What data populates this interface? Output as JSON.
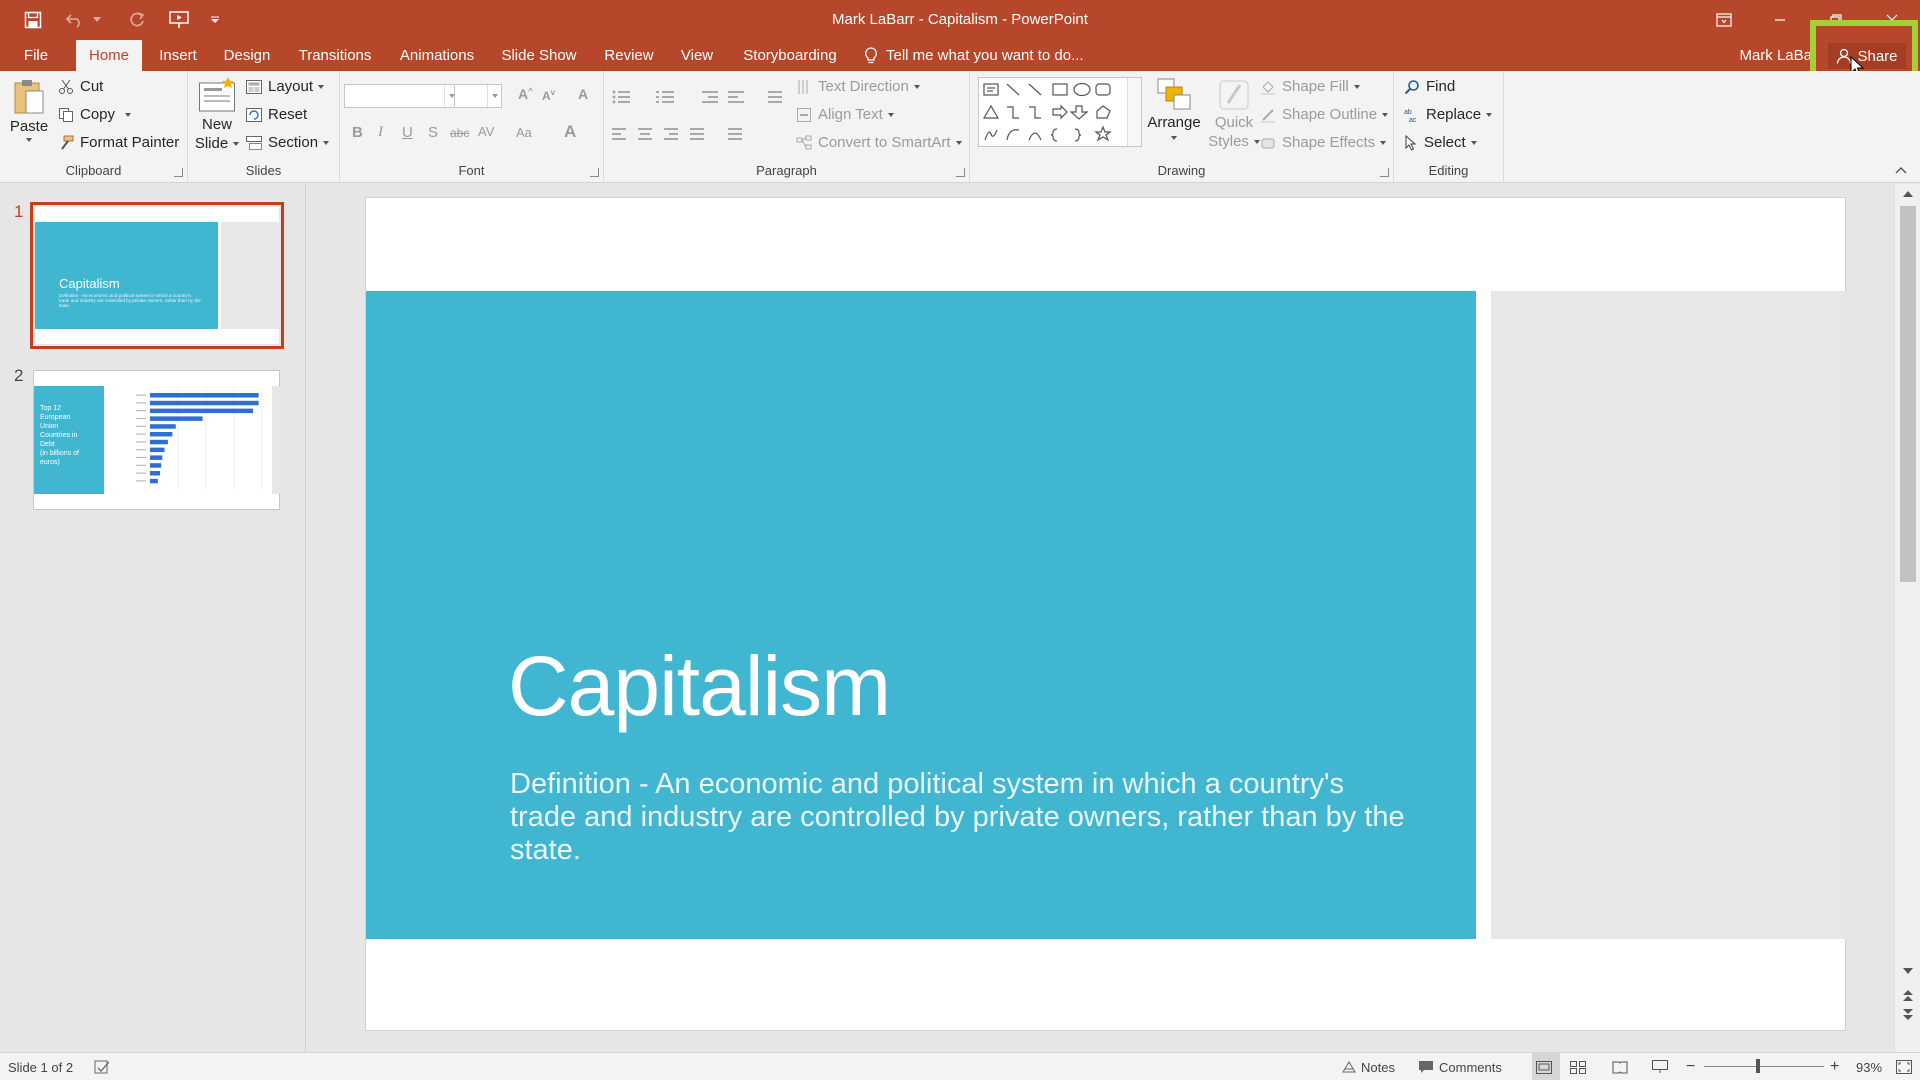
{
  "app": {
    "window_title": "Mark LaBarr - Capitalism - PowerPoint",
    "user_name": "Mark LaBa",
    "share_label": "Share",
    "tell_me": "Tell me what you want to do...",
    "accent_color": "#b7472a",
    "highlight_color": "#a6ce39"
  },
  "tabs": [
    {
      "label": "File"
    },
    {
      "label": "Home",
      "active": true
    },
    {
      "label": "Insert"
    },
    {
      "label": "Design"
    },
    {
      "label": "Transitions"
    },
    {
      "label": "Animations"
    },
    {
      "label": "Slide Show"
    },
    {
      "label": "Review"
    },
    {
      "label": "View"
    },
    {
      "label": "Storyboarding"
    }
  ],
  "ribbon": {
    "clipboard": {
      "label": "Clipboard",
      "paste": "Paste",
      "cut": "Cut",
      "copy": "Copy",
      "format_painter": "Format Painter"
    },
    "slides": {
      "label": "Slides",
      "new_slide_line1": "New",
      "new_slide_line2": "Slide",
      "layout": "Layout",
      "reset": "Reset",
      "section": "Section"
    },
    "font": {
      "label": "Font",
      "font_name": "",
      "font_size": ""
    },
    "paragraph": {
      "label": "Paragraph",
      "text_direction": "Text Direction",
      "align_text": "Align Text",
      "convert_smartart": "Convert to SmartArt"
    },
    "drawing": {
      "label": "Drawing",
      "arrange": "Arrange",
      "quick_styles_line1": "Quick",
      "quick_styles_line2": "Styles",
      "shape_fill": "Shape Fill",
      "shape_outline": "Shape Outline",
      "shape_effects": "Shape Effects"
    },
    "editing": {
      "label": "Editing",
      "find": "Find",
      "replace": "Replace",
      "select": "Select"
    }
  },
  "thumbnails": [
    {
      "number": "1",
      "title": "Capitalism",
      "text": "Definition - An economic and political system in which a country's trade and industry are controlled by private owners, rather than by the state."
    },
    {
      "number": "2",
      "title_lines": [
        "Top 12",
        "European",
        "Union",
        "Countries in",
        "Debt",
        "(in billions of",
        "euros)"
      ],
      "bar_values": [
        0.97,
        0.97,
        0.92,
        0.47,
        0.23,
        0.2,
        0.16,
        0.13,
        0.11,
        0.1,
        0.09,
        0.07
      ]
    }
  ],
  "slide": {
    "title": "Capitalism",
    "subtitle": "Definition - An economic and political system in which a country's trade and industry are controlled by private owners, rather than by the state.",
    "panel_color": "#41b6d1",
    "side_color": "#e7e7e7"
  },
  "status": {
    "slide_info": "Slide 1 of 2",
    "notes": "Notes",
    "comments": "Comments",
    "zoom": "93%"
  }
}
